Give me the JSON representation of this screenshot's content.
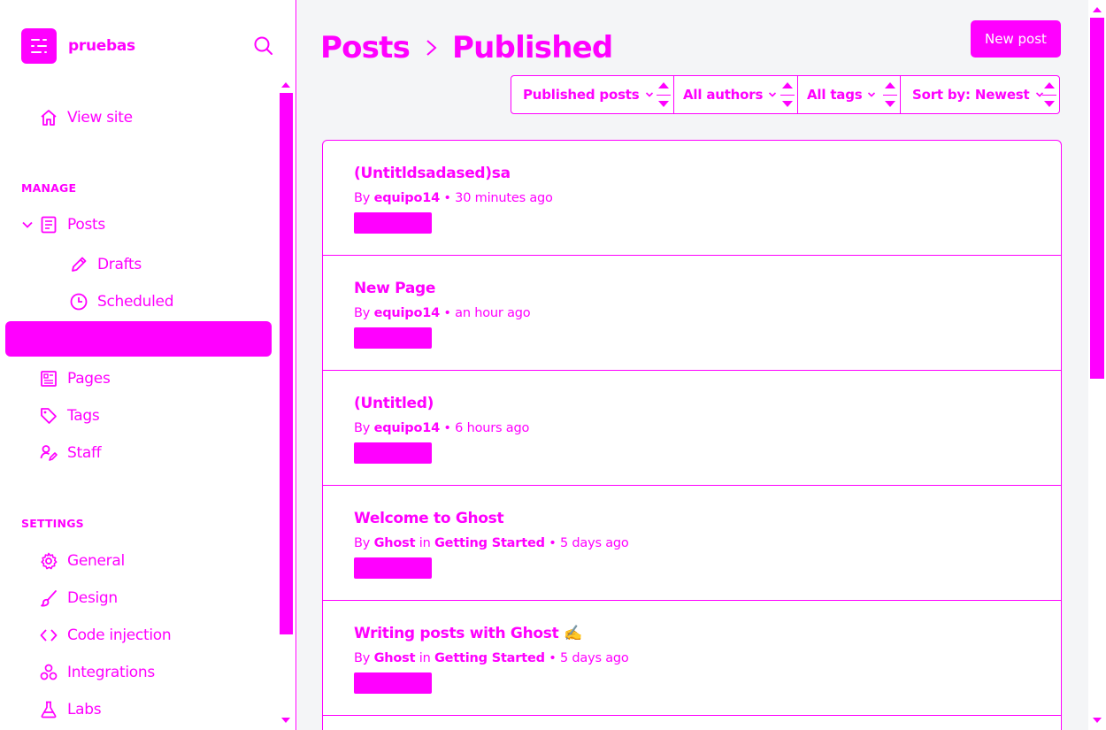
{
  "brand": {
    "name": "pruebas"
  },
  "sidebar": {
    "view_site": "View site",
    "manage_heading": "MANAGE",
    "posts": "Posts",
    "drafts": "Drafts",
    "scheduled": "Scheduled",
    "pages": "Pages",
    "tags": "Tags",
    "staff": "Staff",
    "settings_heading": "SETTINGS",
    "general": "General",
    "design": "Design",
    "code_injection": "Code injection",
    "integrations": "Integrations",
    "labs": "Labs"
  },
  "header": {
    "breadcrumb_root": "Posts",
    "breadcrumb_separator": ">",
    "breadcrumb_current": "Published",
    "new_post": "New post"
  },
  "filters": {
    "type": "Published posts",
    "author": "All authors",
    "tag": "All tags",
    "sort": "Sort by: Newest"
  },
  "posts": [
    {
      "title": "(Untitldsadased)sa",
      "by": "By",
      "author": "equipo14",
      "in": "",
      "tag": "",
      "time": "• 30 minutes ago"
    },
    {
      "title": "New Page",
      "by": "By",
      "author": "equipo14",
      "in": "",
      "tag": "",
      "time": "• an hour ago"
    },
    {
      "title": "(Untitled)",
      "by": "By",
      "author": "equipo14",
      "in": "",
      "tag": "",
      "time": "• 6 hours ago"
    },
    {
      "title": "Welcome to Ghost",
      "by": "By",
      "author": "Ghost",
      "in": "in",
      "tag": "Getting Started",
      "time": "• 5 days ago"
    },
    {
      "title": "Writing posts with Ghost ✍️",
      "by": "By",
      "author": "Ghost",
      "in": "in",
      "tag": "Getting Started",
      "time": "• 5 days ago"
    }
  ],
  "colors": {
    "accent": "#ff00ff",
    "background": "#ffffff",
    "main_background": "#f4f5f7"
  },
  "icons": [
    "home-icon",
    "posts-icon",
    "pencil-icon",
    "clock-icon",
    "pages-icon",
    "tag-icon",
    "staff-icon",
    "gear-icon",
    "brush-icon",
    "code-icon",
    "integrations-icon",
    "flask-icon",
    "search-icon",
    "chevron-down-icon"
  ]
}
